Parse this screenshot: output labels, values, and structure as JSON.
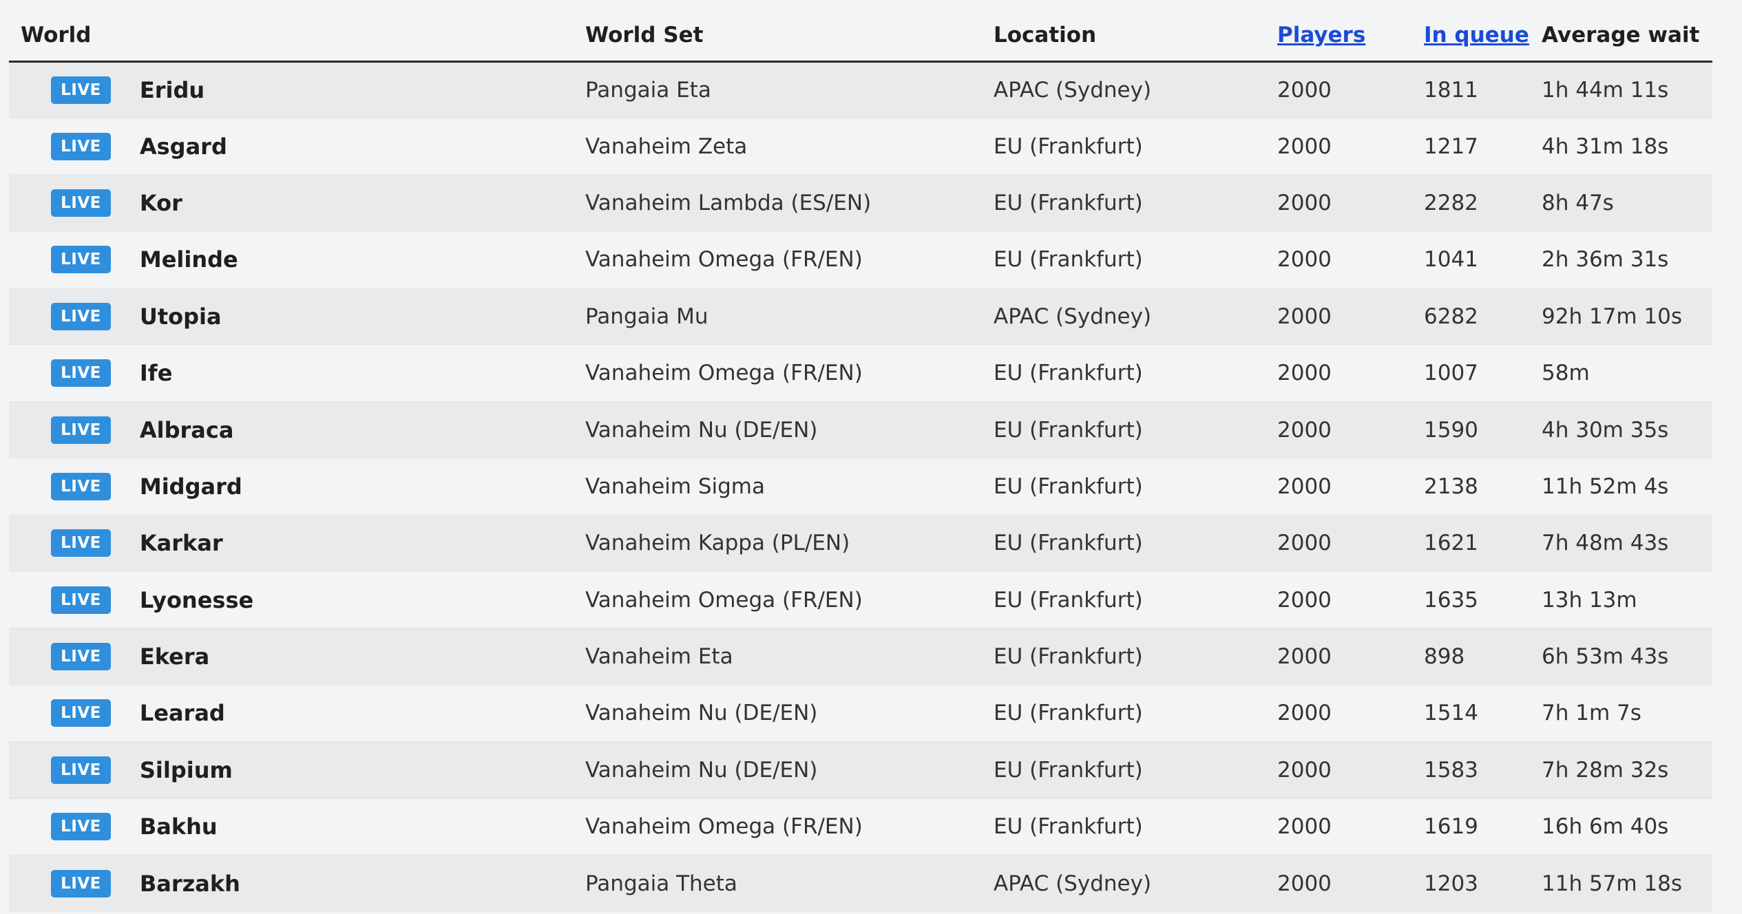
{
  "table": {
    "headers": {
      "world": "World",
      "world_set": "World Set",
      "location": "Location",
      "players": "Players",
      "in_queue": "In queue",
      "average_wait": "Average wait"
    },
    "rows": [
      {
        "status": "LIVE",
        "world": "Eridu",
        "world_set": "Pangaia Eta",
        "location": "APAC (Sydney)",
        "players": "2000",
        "in_queue": "1811",
        "average_wait": "1h 44m 11s"
      },
      {
        "status": "LIVE",
        "world": "Asgard",
        "world_set": "Vanaheim Zeta",
        "location": "EU (Frankfurt)",
        "players": "2000",
        "in_queue": "1217",
        "average_wait": "4h 31m 18s"
      },
      {
        "status": "LIVE",
        "world": "Kor",
        "world_set": "Vanaheim Lambda (ES/EN)",
        "location": "EU (Frankfurt)",
        "players": "2000",
        "in_queue": "2282",
        "average_wait": "8h 47s"
      },
      {
        "status": "LIVE",
        "world": "Melinde",
        "world_set": "Vanaheim Omega (FR/EN)",
        "location": "EU (Frankfurt)",
        "players": "2000",
        "in_queue": "1041",
        "average_wait": "2h 36m 31s"
      },
      {
        "status": "LIVE",
        "world": "Utopia",
        "world_set": "Pangaia Mu",
        "location": "APAC (Sydney)",
        "players": "2000",
        "in_queue": "6282",
        "average_wait": "92h 17m 10s"
      },
      {
        "status": "LIVE",
        "world": "Ife",
        "world_set": "Vanaheim Omega (FR/EN)",
        "location": "EU (Frankfurt)",
        "players": "2000",
        "in_queue": "1007",
        "average_wait": "58m"
      },
      {
        "status": "LIVE",
        "world": "Albraca",
        "world_set": "Vanaheim Nu (DE/EN)",
        "location": "EU (Frankfurt)",
        "players": "2000",
        "in_queue": "1590",
        "average_wait": "4h 30m 35s"
      },
      {
        "status": "LIVE",
        "world": "Midgard",
        "world_set": "Vanaheim Sigma",
        "location": "EU (Frankfurt)",
        "players": "2000",
        "in_queue": "2138",
        "average_wait": "11h 52m 4s"
      },
      {
        "status": "LIVE",
        "world": "Karkar",
        "world_set": "Vanaheim Kappa (PL/EN)",
        "location": "EU (Frankfurt)",
        "players": "2000",
        "in_queue": "1621",
        "average_wait": "7h 48m 43s"
      },
      {
        "status": "LIVE",
        "world": "Lyonesse",
        "world_set": "Vanaheim Omega (FR/EN)",
        "location": "EU (Frankfurt)",
        "players": "2000",
        "in_queue": "1635",
        "average_wait": "13h 13m"
      },
      {
        "status": "LIVE",
        "world": "Ekera",
        "world_set": "Vanaheim Eta",
        "location": "EU (Frankfurt)",
        "players": "2000",
        "in_queue": "898",
        "average_wait": "6h 53m 43s"
      },
      {
        "status": "LIVE",
        "world": "Learad",
        "world_set": "Vanaheim Nu (DE/EN)",
        "location": "EU (Frankfurt)",
        "players": "2000",
        "in_queue": "1514",
        "average_wait": "7h 1m 7s"
      },
      {
        "status": "LIVE",
        "world": "Silpium",
        "world_set": "Vanaheim Nu (DE/EN)",
        "location": "EU (Frankfurt)",
        "players": "2000",
        "in_queue": "1583",
        "average_wait": "7h 28m 32s"
      },
      {
        "status": "LIVE",
        "world": "Bakhu",
        "world_set": "Vanaheim Omega (FR/EN)",
        "location": "EU (Frankfurt)",
        "players": "2000",
        "in_queue": "1619",
        "average_wait": "16h 6m 40s"
      },
      {
        "status": "LIVE",
        "world": "Barzakh",
        "world_set": "Pangaia Theta",
        "location": "APAC (Sydney)",
        "players": "2000",
        "in_queue": "1203",
        "average_wait": "11h 57m 18s"
      }
    ]
  },
  "colors": {
    "live_badge": "#2f8fdc",
    "sort_link": "#1a4bd8",
    "row_alt": "#e9eaec",
    "background": "#f3f4f6"
  }
}
